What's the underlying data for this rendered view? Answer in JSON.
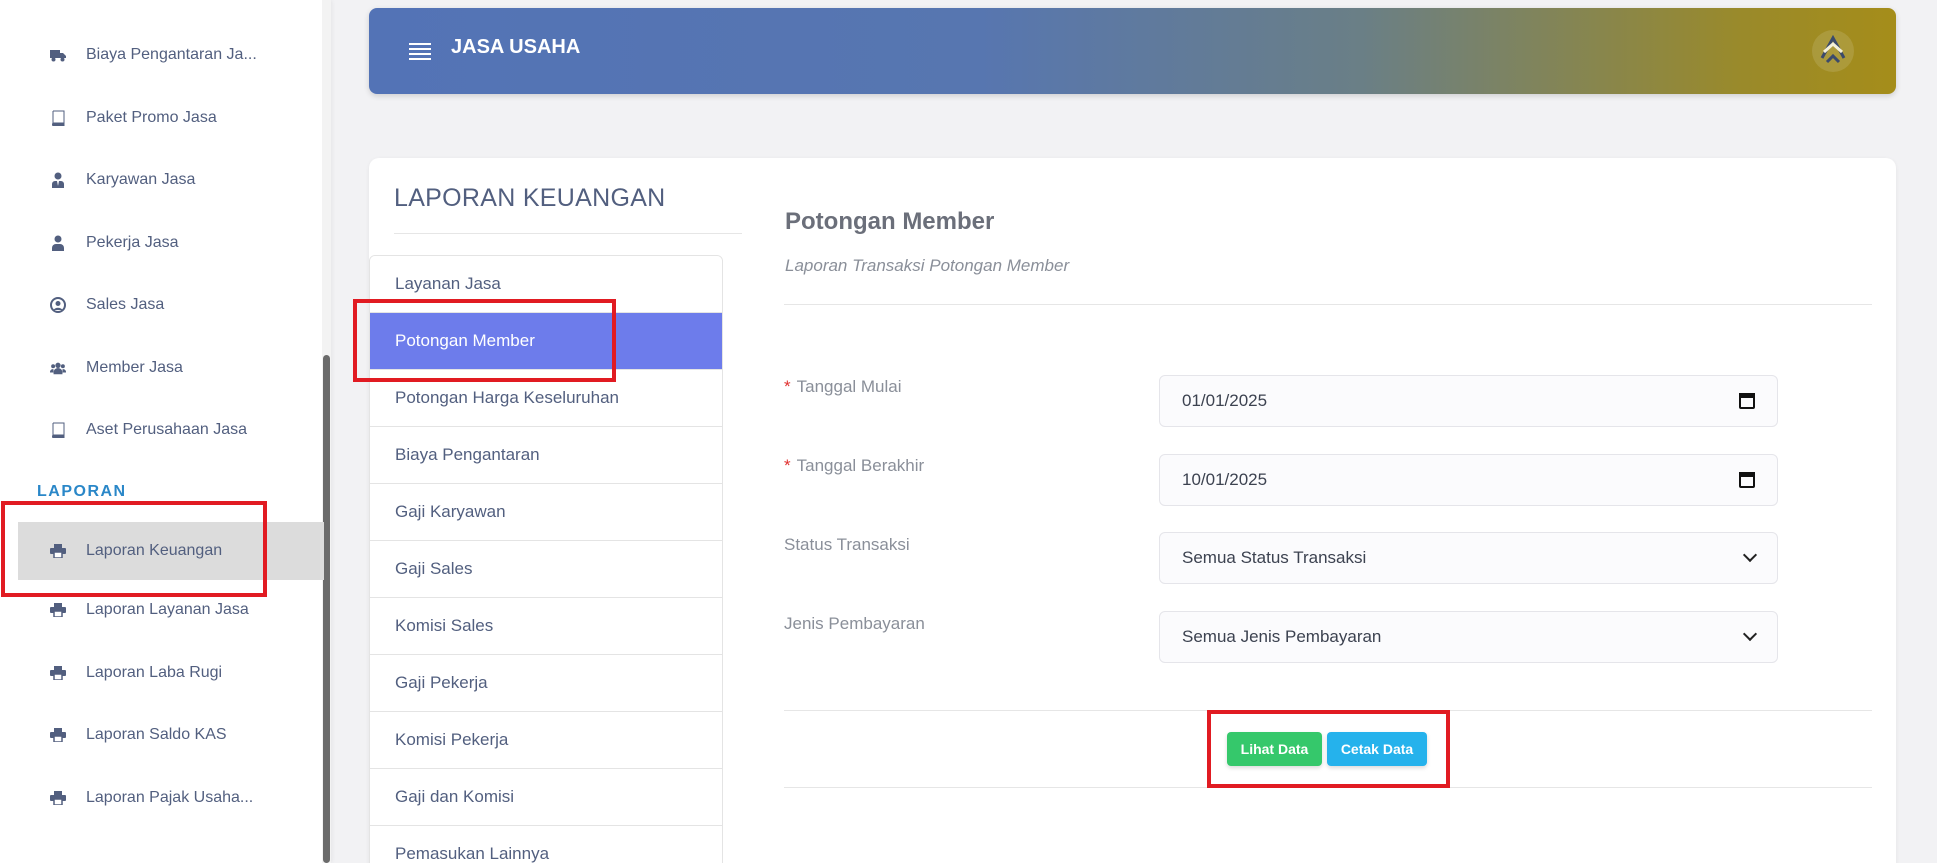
{
  "sidebar": {
    "items": [
      {
        "label": "Biaya Pengantaran Ja...",
        "icon": "truck-icon"
      },
      {
        "label": "Paket Promo Jasa",
        "icon": "book-icon"
      },
      {
        "label": "Karyawan Jasa",
        "icon": "user-tie-icon"
      },
      {
        "label": "Pekerja Jasa",
        "icon": "user-icon"
      },
      {
        "label": "Sales Jasa",
        "icon": "user-circle-icon"
      },
      {
        "label": "Member Jasa",
        "icon": "users-icon"
      },
      {
        "label": "Aset Perusahaan Jasa",
        "icon": "book-icon"
      }
    ],
    "section_label": "LAPORAN",
    "report_items": [
      {
        "label": "Laporan Keuangan",
        "icon": "printer-icon",
        "active": true
      },
      {
        "label": "Laporan Layanan Jasa",
        "icon": "printer-icon"
      },
      {
        "label": "Laporan Laba Rugi",
        "icon": "printer-icon"
      },
      {
        "label": "Laporan Saldo KAS",
        "icon": "printer-icon"
      },
      {
        "label": "Laporan Pajak Usaha...",
        "icon": "printer-icon"
      }
    ]
  },
  "header": {
    "title": "JASA USAHA",
    "menu_icon": "hamburger-icon",
    "logo": "company-logo"
  },
  "card": {
    "title": "LAPORAN KEUANGAN",
    "menu": [
      {
        "label": "Layanan Jasa"
      },
      {
        "label": "Potongan Member",
        "active": true
      },
      {
        "label": "Potongan Harga Keseluruhan"
      },
      {
        "label": "Biaya Pengantaran"
      },
      {
        "label": "Gaji Karyawan"
      },
      {
        "label": "Gaji Sales"
      },
      {
        "label": "Komisi Sales"
      },
      {
        "label": "Gaji Pekerja"
      },
      {
        "label": "Komisi Pekerja"
      },
      {
        "label": "Gaji dan Komisi"
      },
      {
        "label": "Pemasukan Lainnya"
      }
    ]
  },
  "form": {
    "title": "Potongan Member",
    "subtitle": "Laporan Transaksi Potongan Member",
    "required_mark": "*",
    "start_date": {
      "label": "Tanggal Mulai",
      "value": "01/01/2025"
    },
    "end_date": {
      "label": "Tanggal Berakhir",
      "value": "10/01/2025"
    },
    "status": {
      "label": "Status Transaksi",
      "value": "Semua Status Transaksi"
    },
    "payment": {
      "label": "Jenis Pembayaran",
      "value": "Semua Jenis Pembayaran"
    },
    "view_button": "Lihat Data",
    "print_button": "Cetak Data"
  },
  "colors": {
    "active_menu": "#6d7ceb",
    "highlight_box": "#e11b22",
    "view_button": "#35c86b",
    "print_button": "#25b2ec",
    "section_label": "#2a87c8"
  }
}
